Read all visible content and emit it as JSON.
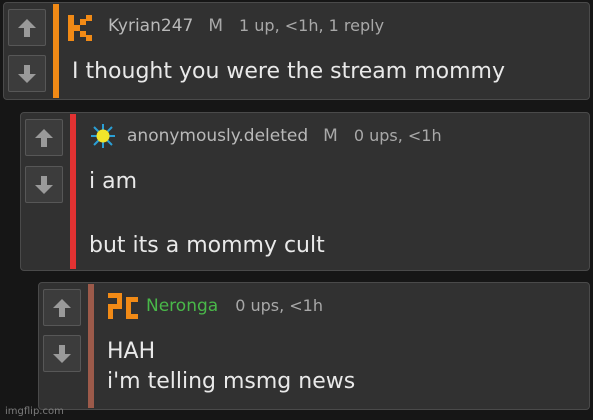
{
  "comments": [
    {
      "username": "Kyrian247",
      "gender": "M",
      "meta": "1 up, <1h, 1 reply",
      "lines": [
        "I thought you were the stream mommy"
      ],
      "bar_color": "#f18a16",
      "avatar_icon": "kyrian247-avatar-icon"
    },
    {
      "username": "anonymously.deleted",
      "gender": "M",
      "meta": "0 ups, <1h",
      "lines": [
        "i am",
        "",
        "but its a mommy cult"
      ],
      "bar_color": "#e23232",
      "avatar_icon": "sun-avatar-icon"
    },
    {
      "username": "Neronga",
      "gender": "",
      "meta": "0 ups, <1h",
      "lines": [
        "HAH",
        "i'm telling msmg news"
      ],
      "bar_color": "#9c5a4a",
      "username_color": "#49b849",
      "avatar_icon": "neronga-avatar-icon"
    }
  ],
  "watermark": "imgflip.com"
}
